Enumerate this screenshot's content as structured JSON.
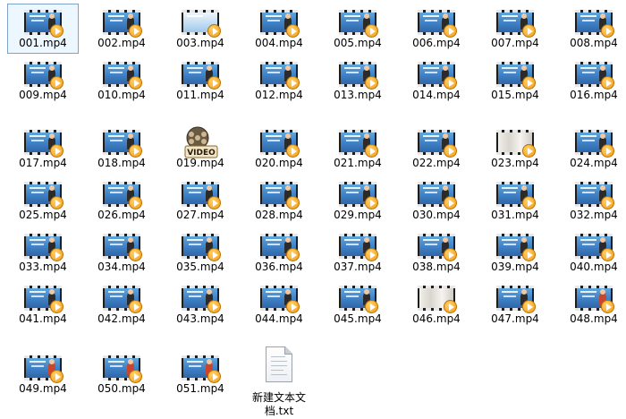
{
  "window": {
    "view": "Large icons"
  },
  "files": [
    {
      "name": "001.mp4",
      "thumb": "video-thumbnail",
      "selected": true
    },
    {
      "name": "002.mp4",
      "thumb": "video-thumbnail"
    },
    {
      "name": "003.mp4",
      "thumb": "video-thumbnail-light"
    },
    {
      "name": "004.mp4",
      "thumb": "video-thumbnail"
    },
    {
      "name": "005.mp4",
      "thumb": "video-thumbnail"
    },
    {
      "name": "006.mp4",
      "thumb": "video-thumbnail"
    },
    {
      "name": "007.mp4",
      "thumb": "video-thumbnail"
    },
    {
      "name": "008.mp4",
      "thumb": "video-thumbnail"
    },
    {
      "name": "009.mp4",
      "thumb": "video-thumbnail"
    },
    {
      "name": "010.mp4",
      "thumb": "video-thumbnail"
    },
    {
      "name": "011.mp4",
      "thumb": "video-thumbnail"
    },
    {
      "name": "012.mp4",
      "thumb": "video-thumbnail"
    },
    {
      "name": "013.mp4",
      "thumb": "video-thumbnail"
    },
    {
      "name": "014.mp4",
      "thumb": "video-thumbnail"
    },
    {
      "name": "015.mp4",
      "thumb": "video-thumbnail"
    },
    {
      "name": "016.mp4",
      "thumb": "video-thumbnail"
    },
    {
      "name": "017.mp4",
      "thumb": "video-thumbnail"
    },
    {
      "name": "018.mp4",
      "thumb": "video-thumbnail"
    },
    {
      "name": "019.mp4",
      "thumb": "video-file-icon",
      "icon_text": "VIDEO"
    },
    {
      "name": "020.mp4",
      "thumb": "video-thumbnail"
    },
    {
      "name": "021.mp4",
      "thumb": "video-thumbnail"
    },
    {
      "name": "022.mp4",
      "thumb": "video-thumbnail"
    },
    {
      "name": "023.mp4",
      "thumb": "video-thumbnail-curtain"
    },
    {
      "name": "024.mp4",
      "thumb": "video-thumbnail"
    },
    {
      "name": "025.mp4",
      "thumb": "video-thumbnail"
    },
    {
      "name": "026.mp4",
      "thumb": "video-thumbnail"
    },
    {
      "name": "027.mp4",
      "thumb": "video-thumbnail"
    },
    {
      "name": "028.mp4",
      "thumb": "video-thumbnail"
    },
    {
      "name": "029.mp4",
      "thumb": "video-thumbnail"
    },
    {
      "name": "030.mp4",
      "thumb": "video-thumbnail"
    },
    {
      "name": "031.mp4",
      "thumb": "video-thumbnail"
    },
    {
      "name": "032.mp4",
      "thumb": "video-thumbnail"
    },
    {
      "name": "033.mp4",
      "thumb": "video-thumbnail"
    },
    {
      "name": "034.mp4",
      "thumb": "video-thumbnail"
    },
    {
      "name": "035.mp4",
      "thumb": "video-thumbnail"
    },
    {
      "name": "036.mp4",
      "thumb": "video-thumbnail"
    },
    {
      "name": "037.mp4",
      "thumb": "video-thumbnail"
    },
    {
      "name": "038.mp4",
      "thumb": "video-thumbnail"
    },
    {
      "name": "039.mp4",
      "thumb": "video-thumbnail"
    },
    {
      "name": "040.mp4",
      "thumb": "video-thumbnail"
    },
    {
      "name": "041.mp4",
      "thumb": "video-thumbnail"
    },
    {
      "name": "042.mp4",
      "thumb": "video-thumbnail"
    },
    {
      "name": "043.mp4",
      "thumb": "video-thumbnail"
    },
    {
      "name": "044.mp4",
      "thumb": "video-thumbnail"
    },
    {
      "name": "045.mp4",
      "thumb": "video-thumbnail"
    },
    {
      "name": "046.mp4",
      "thumb": "video-thumbnail-curtain"
    },
    {
      "name": "047.mp4",
      "thumb": "video-thumbnail"
    },
    {
      "name": "048.mp4",
      "thumb": "video-thumbnail-red"
    },
    {
      "name": "049.mp4",
      "thumb": "video-thumbnail-red"
    },
    {
      "name": "050.mp4",
      "thumb": "video-thumbnail-red"
    },
    {
      "name": "051.mp4",
      "thumb": "video-thumbnail-red"
    },
    {
      "name": "新建文本文档.txt",
      "thumb": "text-document-icon"
    }
  ],
  "colors": {
    "selection_border": "#7da2ce",
    "play_badge": "#f39a10",
    "screen_blue": "#3f7fc4"
  }
}
